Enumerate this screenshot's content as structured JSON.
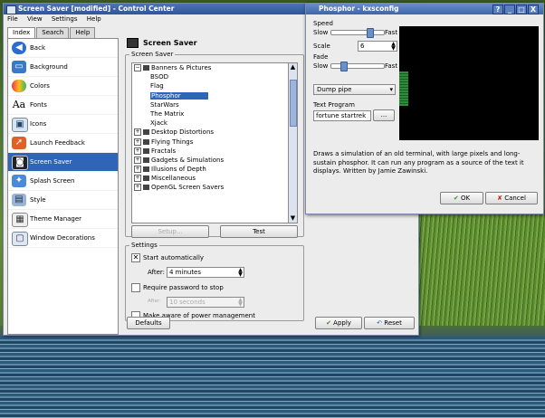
{
  "main_window": {
    "title": "Screen Saver [modified] - Control Center",
    "menu": [
      "File",
      "View",
      "Settings",
      "Help"
    ],
    "tabs": [
      "Index",
      "Search",
      "Help"
    ],
    "sidebar": [
      {
        "label": "Back",
        "icon": "back-arrow-icon"
      },
      {
        "label": "Background",
        "icon": "background-icon"
      },
      {
        "label": "Colors",
        "icon": "colors-icon"
      },
      {
        "label": "Fonts",
        "icon": "fonts-icon"
      },
      {
        "label": "Icons",
        "icon": "icons-icon"
      },
      {
        "label": "Launch Feedback",
        "icon": "launch-feedback-icon"
      },
      {
        "label": "Screen Saver",
        "icon": "screen-saver-icon",
        "selected": true
      },
      {
        "label": "Splash Screen",
        "icon": "splash-screen-icon"
      },
      {
        "label": "Style",
        "icon": "style-icon"
      },
      {
        "label": "Theme Manager",
        "icon": "theme-manager-icon"
      },
      {
        "label": "Window Decorations",
        "icon": "window-decorations-icon"
      }
    ],
    "header": "Screen Saver",
    "saver_group_label": "Screen Saver",
    "tree": [
      {
        "label": "Banners & Pictures",
        "level": 0,
        "expand": "−"
      },
      {
        "label": "BSOD",
        "level": 1
      },
      {
        "label": "Flag",
        "level": 1
      },
      {
        "label": "Phosphor",
        "level": 1,
        "selected": true
      },
      {
        "label": "StarWars",
        "level": 1
      },
      {
        "label": "The Matrix",
        "level": 1
      },
      {
        "label": "Xjack",
        "level": 1
      },
      {
        "label": "Desktop Distortions",
        "level": 0,
        "expand": "+"
      },
      {
        "label": "Flying Things",
        "level": 0,
        "expand": "+"
      },
      {
        "label": "Fractals",
        "level": 0,
        "expand": "+"
      },
      {
        "label": "Gadgets & Simulations",
        "level": 0,
        "expand": "+"
      },
      {
        "label": "Illusions of Depth",
        "level": 0,
        "expand": "+"
      },
      {
        "label": "Miscellaneous",
        "level": 0,
        "expand": "+"
      },
      {
        "label": "OpenGL Screen Savers",
        "level": 0,
        "expand": "+"
      }
    ],
    "setup_button": "Setup...",
    "test_button": "Test",
    "settings_group_label": "Settings",
    "start_automatically": "Start automatically",
    "after_label": "After:",
    "after_value": "4 minutes",
    "require_password": "Require password to stop",
    "after2_label": "After:",
    "after2_value": "10 seconds",
    "power_mgmt": "Make aware of power management",
    "defaults_button": "Defaults",
    "apply_button": "Apply",
    "reset_button": "Reset"
  },
  "dialog": {
    "title": "Phosphor - kxsconfig",
    "title_buttons": [
      "?",
      "_",
      "□",
      "X"
    ],
    "speed_label": "Speed",
    "slow_label": "Slow",
    "fast_label": "Fast",
    "speed_level": 0.75,
    "scale_label": "Scale",
    "scale_value": "6",
    "fade_label": "Fade",
    "fade_slow_label": "Slow",
    "fade_fast_label": "Fast",
    "fade_level": 0.2,
    "mode_value": "Dump pipe",
    "text_program_label": "Text Program",
    "text_program_value": "fortune startrek",
    "browse_button": "...",
    "description": "Draws a simulation of an old terminal, with large pixels and long-sustain phosphor. It can run any program as a source of the text it displays.  Written by Jamie Zawinski.",
    "ok_button": "OK",
    "cancel_button": "Cancel"
  }
}
